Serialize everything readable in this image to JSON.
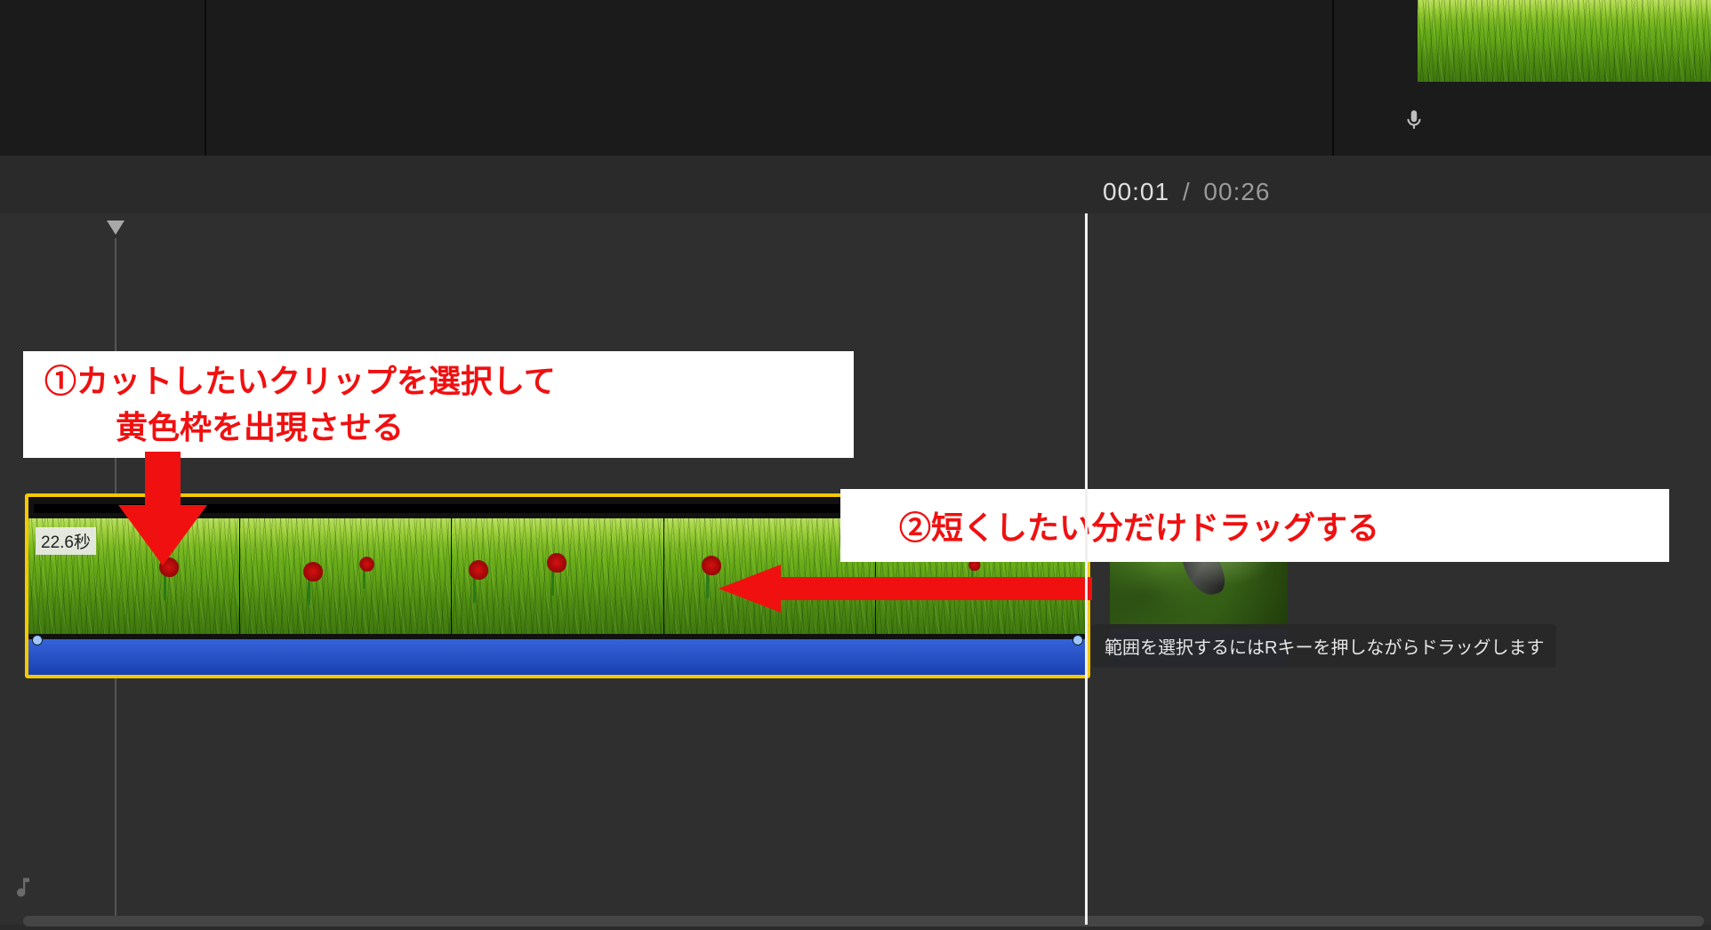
{
  "time": {
    "current": "00:01",
    "separator": "/",
    "duration": "00:26"
  },
  "clip": {
    "duration_badge": "22.6秒"
  },
  "annotations": {
    "step1_line1": "①カットしたいクリップを選択して",
    "step1_line2": "黄色枠を出現させる",
    "step2": "②短くしたい分だけドラッグする"
  },
  "tooltip": "範囲を選択するにはRキーを押しながらドラッグします",
  "colors": {
    "selection": "#f5c800",
    "annotation": "#f01010",
    "audio": "#1940b2"
  }
}
